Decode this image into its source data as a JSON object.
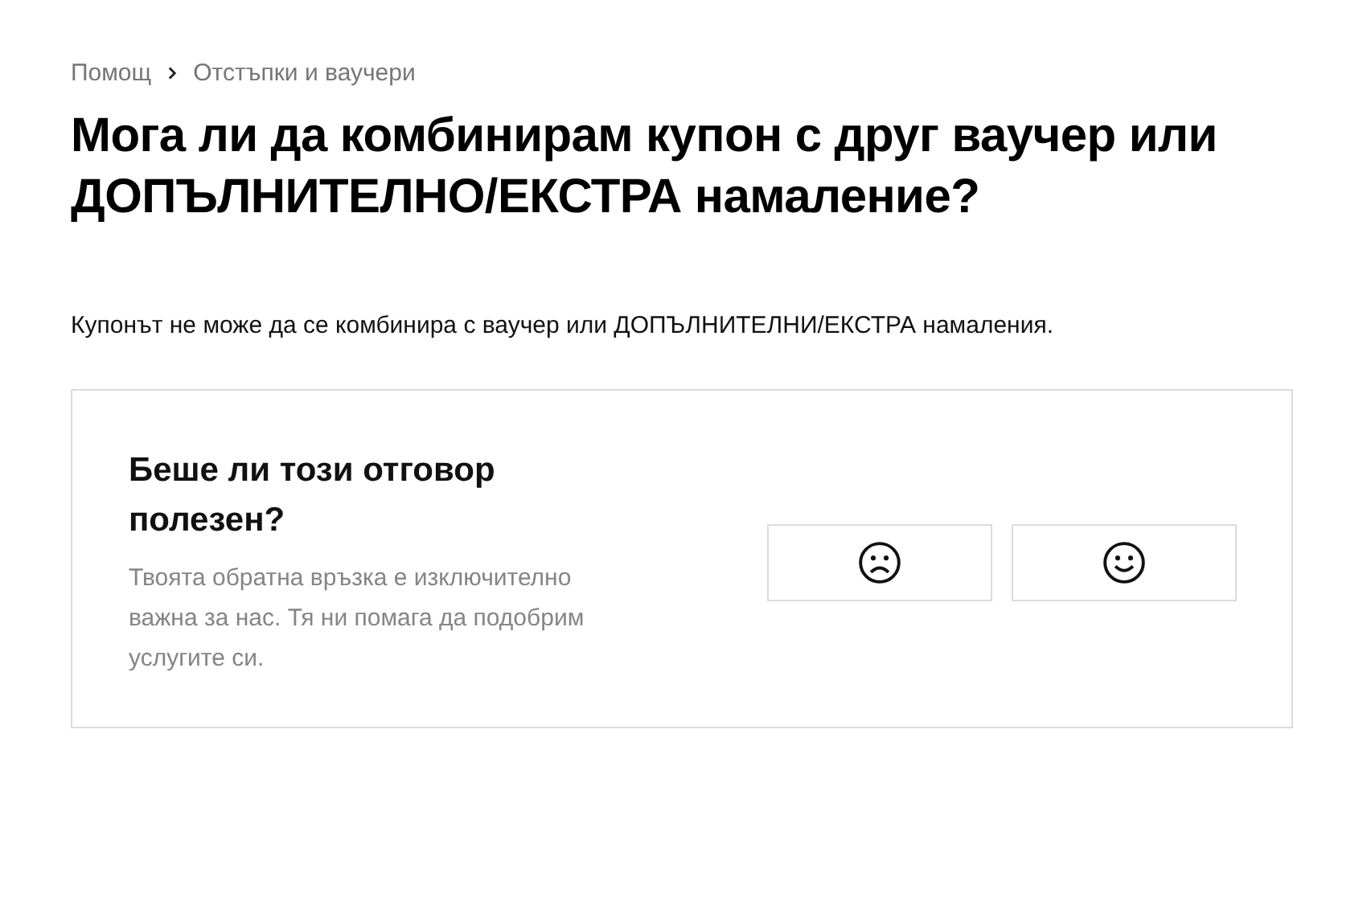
{
  "breadcrumb": [
    {
      "label": "Помощ"
    },
    {
      "label": "Отстъпки и ваучери"
    }
  ],
  "title": "Мога ли да комбинирам купон с друг ваучер или ДОПЪЛНИТЕЛНО/ЕКСТРА намаление?",
  "answer": "Купонът не може да се комбинира с ваучер или ДОПЪЛНИТЕЛНИ/ЕКСТРА намаления.",
  "feedback": {
    "question": "Беше ли този отговор полезен?",
    "description": "Твоята обратна връзка е изключително важна за нас. Тя ни помага да подобрим услугите си.",
    "buttons": [
      {
        "kind": "sad"
      },
      {
        "kind": "happy"
      }
    ]
  }
}
